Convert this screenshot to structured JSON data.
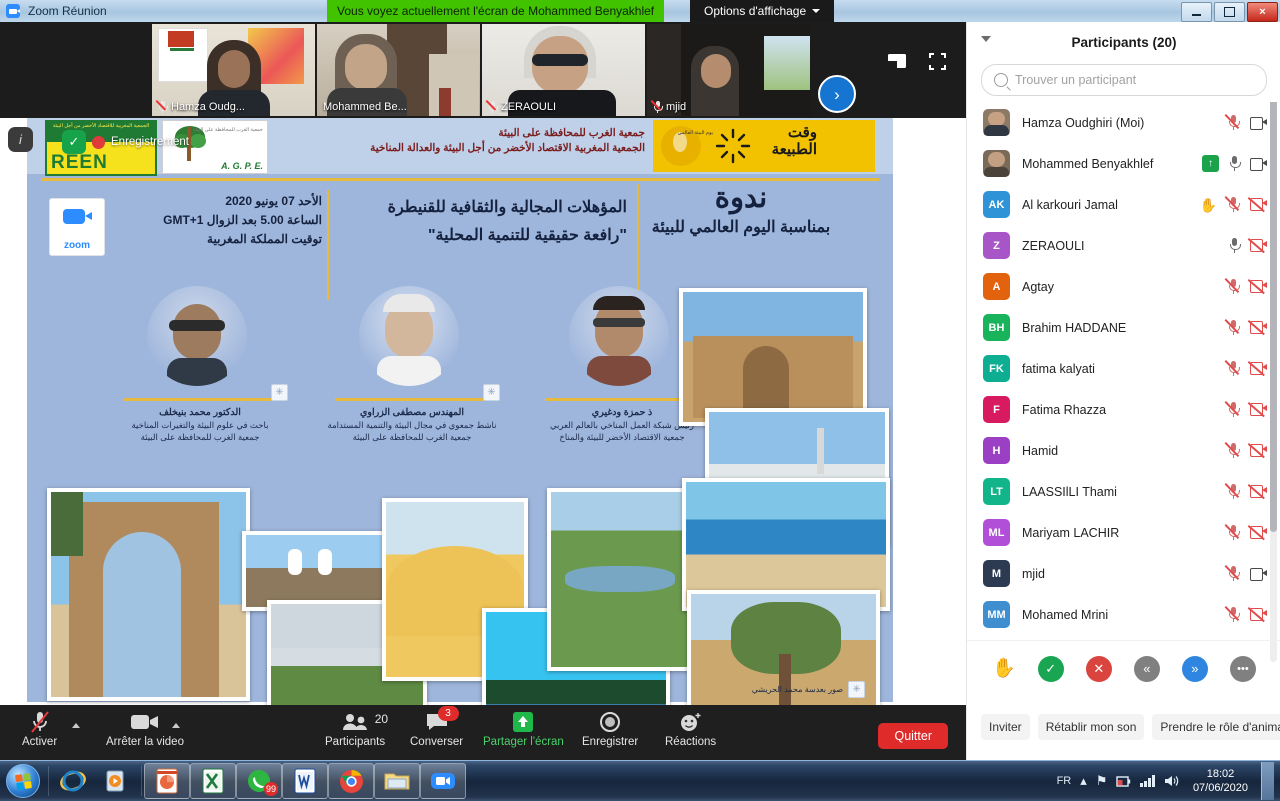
{
  "window": {
    "app_icon": "zoom-camera-icon",
    "title": "Zoom Réunion",
    "share_banner": "Vous voyez actuellement l'écran de Mohammed Benyakhlef",
    "view_options": "Options d'affichage",
    "minimize": "minimize-icon",
    "maximize": "restore-icon",
    "close": "×"
  },
  "filmstrip": {
    "thumbnails": [
      {
        "name": "Hamza Oudg...",
        "muted": true,
        "active": false
      },
      {
        "name": "Mohammed Be...",
        "muted": false,
        "active": true
      },
      {
        "name": "ZERAOULI",
        "muted": true,
        "active": false
      },
      {
        "name": "mjid",
        "muted": true,
        "active": false
      }
    ],
    "next_arrow": "›",
    "view_icons": [
      "minimize-view-icon",
      "fullscreen-icon"
    ]
  },
  "recording": {
    "label": "Enregistrement",
    "info_icon": "info-icon",
    "shield_icon": "shield-check-icon"
  },
  "poster": {
    "association_line1": "جمعية الغرب للمحافظة على البيئة",
    "association_line2": "الجمعية المغربية الاقتصاد الأخضر من أجل البيئة والعدالة المناخية",
    "green_logo_text": "REEN",
    "green_logo_arabic": "الجمعية المغربية للاقتصاد الأخضر من أجل البيئة",
    "agpe_logo_text": "A. G. P. E.",
    "agpe_logo_arabic": "جمعية الغرب للمحافظة على البيئة",
    "nature_time_line1": "وقت",
    "nature_time_line2": "الطبيعة",
    "world_day_badge": "يوم البيئة العالمي",
    "zoom_logo_label": "zoom",
    "date_line1": "الأحد 07 يونيو 2020",
    "date_line2": "الساعة 5.00 بعد الزوال GMT+1",
    "date_line3": "توقيت المملكة المغربية",
    "subtitle_line1": "المؤهلات المجالية والثقافية للقنيطرة",
    "subtitle_line2": "\"رافعة حقيقية للتنمية المحلية\"",
    "title_main": "ندوة",
    "title_sub1": "بمناسبة اليوم العالمي للبيئة",
    "speakers": [
      {
        "name": "الدكتور محمد بنيخلف",
        "role1": "باحث في علوم البيئة والتغيرات المناخية",
        "role2": "جمعية الغرب للمحافظة على البيئة"
      },
      {
        "name": "المهندس مصطفى الزراوي",
        "role1": "ناشط جمعوي في مجال البيئة والتنمية المستدامة",
        "role2": "جمعية الغرب للمحافظة على البيئة"
      },
      {
        "name": "ذ حمزة ودغيري",
        "role1": "رئيس شبكة العمل المناخي بالعالم العربي",
        "role2": "جمعية الاقتصاد الأخضر للبيئة والمناخ"
      }
    ],
    "photo_credit": "صور بعدسة محمد الحريشي"
  },
  "toolbar": {
    "mute": {
      "label": "Activer",
      "icon": "mic-muted-icon"
    },
    "video": {
      "label": "Arrêter la video",
      "icon": "camera-icon"
    },
    "participants": {
      "label": "Participants",
      "count": "20",
      "icon": "people-icon"
    },
    "chat": {
      "label": "Converser",
      "icon": "chat-bubble-icon",
      "badge": "3"
    },
    "share": {
      "label": "Partager l'écran",
      "icon": "share-up-arrow-icon"
    },
    "record": {
      "label": "Enregistrer",
      "icon": "record-circle-icon"
    },
    "reactions": {
      "label": "Réactions",
      "icon": "smiley-icon"
    },
    "leave": {
      "label": "Quitter"
    }
  },
  "panel": {
    "title": "Participants (20)",
    "collapse_icon": "chevron-down-icon",
    "search_placeholder": "Trouver un participant",
    "search_value": "",
    "search_icon": "search-icon",
    "participants": [
      {
        "name": "Hamza Oudghiri (Moi)",
        "initials": "",
        "avatar_color": "#8c7a66",
        "photo": true,
        "mic": "off",
        "cam": "on",
        "host": false,
        "hand": false
      },
      {
        "name": "Mohammed Benyakhlef",
        "initials": "",
        "avatar_color": "#7a6a58",
        "photo": true,
        "mic": "on",
        "cam": "on",
        "host": true,
        "hand": false
      },
      {
        "name": "Al karkouri Jamal",
        "initials": "AK",
        "avatar_color": "#2f93d8",
        "photo": false,
        "mic": "off",
        "cam": "off",
        "host": false,
        "hand": true
      },
      {
        "name": "ZERAOULI",
        "initials": "Z",
        "avatar_color": "#a855c8",
        "photo": false,
        "mic": "on",
        "cam": "off",
        "host": false,
        "hand": false
      },
      {
        "name": "Agtay",
        "initials": "A",
        "avatar_color": "#e2620e",
        "photo": false,
        "mic": "off",
        "cam": "off",
        "host": false,
        "hand": false
      },
      {
        "name": "Brahim HADDANE",
        "initials": "BH",
        "avatar_color": "#19b35c",
        "photo": false,
        "mic": "off",
        "cam": "off",
        "host": false,
        "hand": false
      },
      {
        "name": "fatima kalyati",
        "initials": "FK",
        "avatar_color": "#0eae93",
        "photo": false,
        "mic": "off",
        "cam": "off",
        "host": false,
        "hand": false
      },
      {
        "name": "Fatima Rhazza",
        "initials": "F",
        "avatar_color": "#d81b60",
        "photo": false,
        "mic": "off",
        "cam": "off",
        "host": false,
        "hand": false
      },
      {
        "name": "Hamid",
        "initials": "H",
        "avatar_color": "#9b3fc4",
        "photo": false,
        "mic": "off",
        "cam": "off",
        "host": false,
        "hand": false
      },
      {
        "name": "LAASSIlLI Thami",
        "initials": "LT",
        "avatar_color": "#12b58a",
        "photo": false,
        "mic": "off",
        "cam": "off",
        "host": false,
        "hand": false
      },
      {
        "name": "Mariyam LACHIR",
        "initials": "ML",
        "avatar_color": "#b14fd8",
        "photo": false,
        "mic": "off",
        "cam": "off",
        "host": false,
        "hand": false
      },
      {
        "name": "mjid",
        "initials": "M",
        "avatar_color": "#2c3a52",
        "photo": false,
        "mic": "off",
        "cam": "on",
        "host": false,
        "hand": false
      },
      {
        "name": "Mohamed Mrini",
        "initials": "MM",
        "avatar_color": "#3f8fd0",
        "photo": false,
        "mic": "off",
        "cam": "off",
        "host": false,
        "hand": false
      }
    ],
    "reactions": [
      {
        "name": "raise-hand",
        "glyph": "✋",
        "color": "#2f6fd0",
        "filled": false
      },
      {
        "name": "yes-check",
        "glyph": "✓",
        "color": "#19a552",
        "filled": true
      },
      {
        "name": "no-cross",
        "glyph": "✕",
        "color": "#d9443f",
        "filled": true
      },
      {
        "name": "slower",
        "glyph": "«",
        "color": "#808080",
        "filled": true
      },
      {
        "name": "faster",
        "glyph": "»",
        "color": "#2f86e0",
        "filled": true
      },
      {
        "name": "more-options",
        "glyph": "•••",
        "color": "#808080",
        "filled": true
      }
    ],
    "buttons": [
      "Inviter",
      "Rétablir mon son",
      "Prendre le rôle d'animateur"
    ]
  },
  "taskbar": {
    "start_icon": "windows-start-orb",
    "apps": [
      {
        "name": "internet-explorer-icon",
        "pinned": true
      },
      {
        "name": "media-player-icon",
        "pinned": true
      },
      {
        "name": "powerpoint-icon",
        "pinned": false
      },
      {
        "name": "excel-icon",
        "pinned": false
      },
      {
        "name": "whatsapp-icon",
        "pinned": false,
        "badge": "99"
      },
      {
        "name": "word-icon",
        "pinned": false
      },
      {
        "name": "chrome-icon",
        "pinned": false
      },
      {
        "name": "file-explorer-icon",
        "pinned": false
      },
      {
        "name": "zoom-icon",
        "pinned": false
      }
    ],
    "tray": {
      "language": "FR",
      "show_hidden_icon": "chevron-up-icon",
      "flag_icon": "action-center-flag-icon",
      "battery_icon": "battery-icon",
      "network_icon": "network-bars-icon",
      "volume_icon": "speaker-icon",
      "time": "18:02",
      "date": "07/06/2020"
    }
  }
}
